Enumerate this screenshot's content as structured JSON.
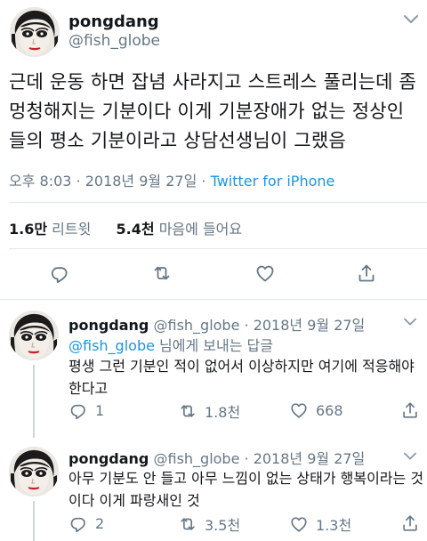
{
  "main_tweet": {
    "display_name": "pongdang",
    "handle": "@fish_globe",
    "text": "근데 운동 하면 잡념 사라지고 스트레스 풀리는데 좀 멍청해지는 기분이다 이게 기분장애가 없는 정상인들의 평소 기분이라고 상담선생님이 그랬음",
    "time": "오후 8:03 · 2018년 9월 27일 · ",
    "source": "Twitter for iPhone",
    "retweets_count": "1.6만",
    "retweets_label": "리트윗",
    "likes_count": "5.4천",
    "likes_label": "마음에 들어요",
    "icons": [
      "reply-icon",
      "retweet-icon",
      "like-icon",
      "share-icon"
    ]
  },
  "replies": [
    {
      "display_name": "pongdang",
      "meta": "@fish_globe · 2018년 9월 27일",
      "replying_to_mention": "@fish_globe",
      "replying_to_suffix": " 님에게 보내는 답글",
      "text": "평생 그런 기분인 적이 없어서 이상하지만 여기에 적응해야 한다고",
      "reply_count": "1",
      "retweet_count": "1.8천",
      "like_count": "668"
    },
    {
      "display_name": "pongdang",
      "meta": "@fish_globe · 2018년 9월 27일",
      "text": "아무 기분도 안 들고 아무 느낌이 없는 상태가 행복이라는 것이다 이게 파랑새인 것",
      "reply_count": "2",
      "retweet_count": "3.5천",
      "like_count": "1.3천"
    }
  ],
  "colors": {
    "text": "#14171a",
    "secondary": "#657786",
    "link": "#1b95e0",
    "divider": "#e1e8ed"
  }
}
